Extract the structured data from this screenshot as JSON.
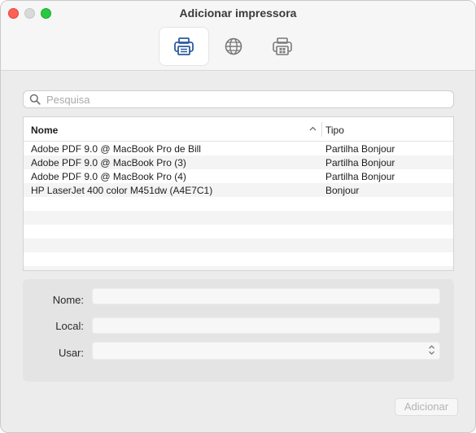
{
  "window": {
    "title": "Adicionar impressora"
  },
  "toolbar": {
    "items": [
      {
        "icon": "printer-default-icon",
        "active": true
      },
      {
        "icon": "globe-ip-icon",
        "active": false
      },
      {
        "icon": "printer-windows-icon",
        "active": false
      }
    ]
  },
  "search": {
    "placeholder": "Pesquisa",
    "value": ""
  },
  "table": {
    "columns": [
      "Nome",
      "Tipo"
    ],
    "sort": {
      "column": "Nome",
      "direction": "ascending"
    },
    "rows": [
      {
        "name": "Adobe PDF 9.0 @ MacBook Pro de Bill",
        "kind": "Partilha Bonjour"
      },
      {
        "name": "Adobe PDF 9.0 @ MacBook Pro (3)",
        "kind": "Partilha Bonjour"
      },
      {
        "name": "Adobe PDF 9.0 @ MacBook Pro (4)",
        "kind": "Partilha Bonjour"
      },
      {
        "name": "HP LaserJet 400 color M451dw (A4E7C1)",
        "kind": "Bonjour"
      }
    ]
  },
  "details": {
    "name_label": "Nome:",
    "name_value": "",
    "location_label": "Local:",
    "location_value": "",
    "use_label": "Usar:",
    "use_value": ""
  },
  "buttons": {
    "add_label": "Adicionar"
  },
  "colors": {
    "close": "#fe5f57",
    "minimize": "#d9d9d9",
    "zoom": "#28c840",
    "accent": "#2c5aa0"
  }
}
